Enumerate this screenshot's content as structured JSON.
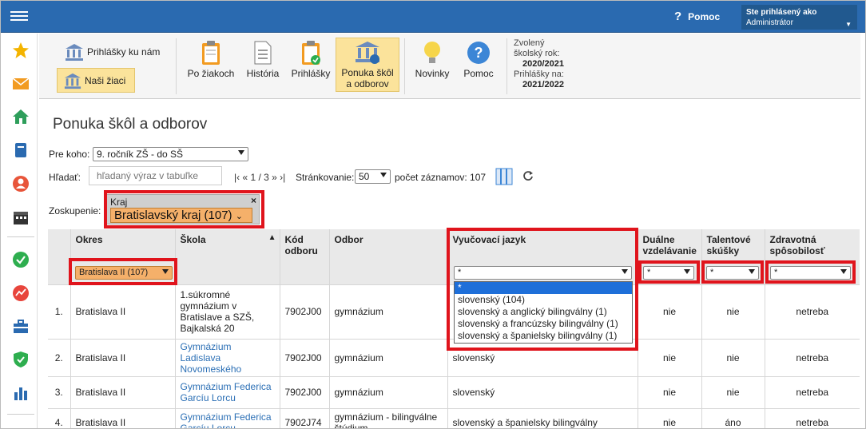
{
  "topbar": {
    "help_label": "Pomoc",
    "help_icon": "question-icon",
    "user_line1": "Ste prihlásený ako",
    "user_line2": "Administrátor"
  },
  "sidebar": {
    "icons": [
      "star-icon",
      "envelope-icon",
      "home-icon",
      "book-icon",
      "user-icon",
      "calendar-icon",
      "check-circle-icon",
      "chart-circle-icon",
      "briefcase-icon",
      "shield-icon",
      "bar-chart-icon"
    ]
  },
  "toolbar": {
    "prihlasky_ku_nam": "Prihlášky ku nám",
    "nasi_ziaci": "Naši žiaci",
    "po_ziakoch": "Po žiakoch",
    "historia": "História",
    "prihlasky": "Prihlášky",
    "ponuka_l1": "Ponuka škôl",
    "ponuka_l2": "a odborov",
    "novinky": "Novinky",
    "pomoc": "Pomoc",
    "year_l1": "Zvolený",
    "year_l2": "školský rok:",
    "year_val": "2020/2021",
    "apps_l1": "Prihlášky na:",
    "apps_val": "2021/2022"
  },
  "page": {
    "title": "Ponuka škôl a odborov",
    "pre_koho_label": "Pre koho:",
    "pre_koho_value": "9. ročník ZŠ - do SŠ",
    "hladat_label": "Hľadať:",
    "search_placeholder": "hľadaný výraz v tabuľke",
    "pager": "|‹ « 1 / 3 » ›|",
    "strankovanie_label": "Stránkovanie:",
    "page_size": "50",
    "count_text": "počet záznamov: 107",
    "zoskupenie_label": "Zoskupenie:",
    "group_title": "Kraj",
    "group_value": "Bratislavský kraj (107)",
    "group_close": "×"
  },
  "table": {
    "headers": {
      "okres": "Okres",
      "skola": "Škola",
      "kod": "Kód odboru",
      "odbor": "Odbor",
      "jazyk": "Vyučovací jazyk",
      "dualne": "Duálne vzdelávanie",
      "talent": "Talentové skúšky",
      "zdrav": "Zdravotná spôsobilosť"
    },
    "okres_filter": "Bratislava II (107)",
    "filter_all": "*",
    "sort_icon": "▲",
    "rows": [
      {
        "n": "1.",
        "okres": "Bratislava II",
        "skola": "1.súkromné gymnázium v Bratislave a SZŠ, Bajkalská 20",
        "kod": "7902J00",
        "odbor": "gymnázium",
        "jazyk": "",
        "dualne": "nie",
        "talent": "nie",
        "zdrav": "netreba"
      },
      {
        "n": "2.",
        "okres": "Bratislava II",
        "skola": "Gymnázium Ladislava Novomeského",
        "kod": "7902J00",
        "odbor": "gymnázium",
        "jazyk": "slovenský",
        "dualne": "nie",
        "talent": "nie",
        "zdrav": "netreba"
      },
      {
        "n": "3.",
        "okres": "Bratislava II",
        "skola": "Gymnázium Federica Garcíu Lorcu",
        "kod": "7902J00",
        "odbor": "gymnázium",
        "jazyk": "slovenský",
        "dualne": "nie",
        "talent": "nie",
        "zdrav": "netreba"
      },
      {
        "n": "4.",
        "okres": "Bratislava II",
        "skola": "Gymnázium Federica Garcíu Lorcu",
        "kod": "7902J74",
        "odbor": "gymnázium - bilingválne štúdium",
        "jazyk": "slovenský a španielsky bilingválny",
        "dualne": "nie",
        "talent": "áno",
        "zdrav": "netreba"
      }
    ],
    "jazyk_options": [
      "*",
      "slovenský (104)",
      "slovenský a anglický bilingválny (1)",
      "slovenský a francúzsky bilingválny (1)",
      "slovenský a španielsky bilingválny (1)"
    ]
  },
  "colors": {
    "topbar": "#2a6ab0",
    "highlight_red": "#e0141c",
    "active_tab": "#fbe39b",
    "group_select": "#f5b06a",
    "link": "#2b6fb5"
  }
}
